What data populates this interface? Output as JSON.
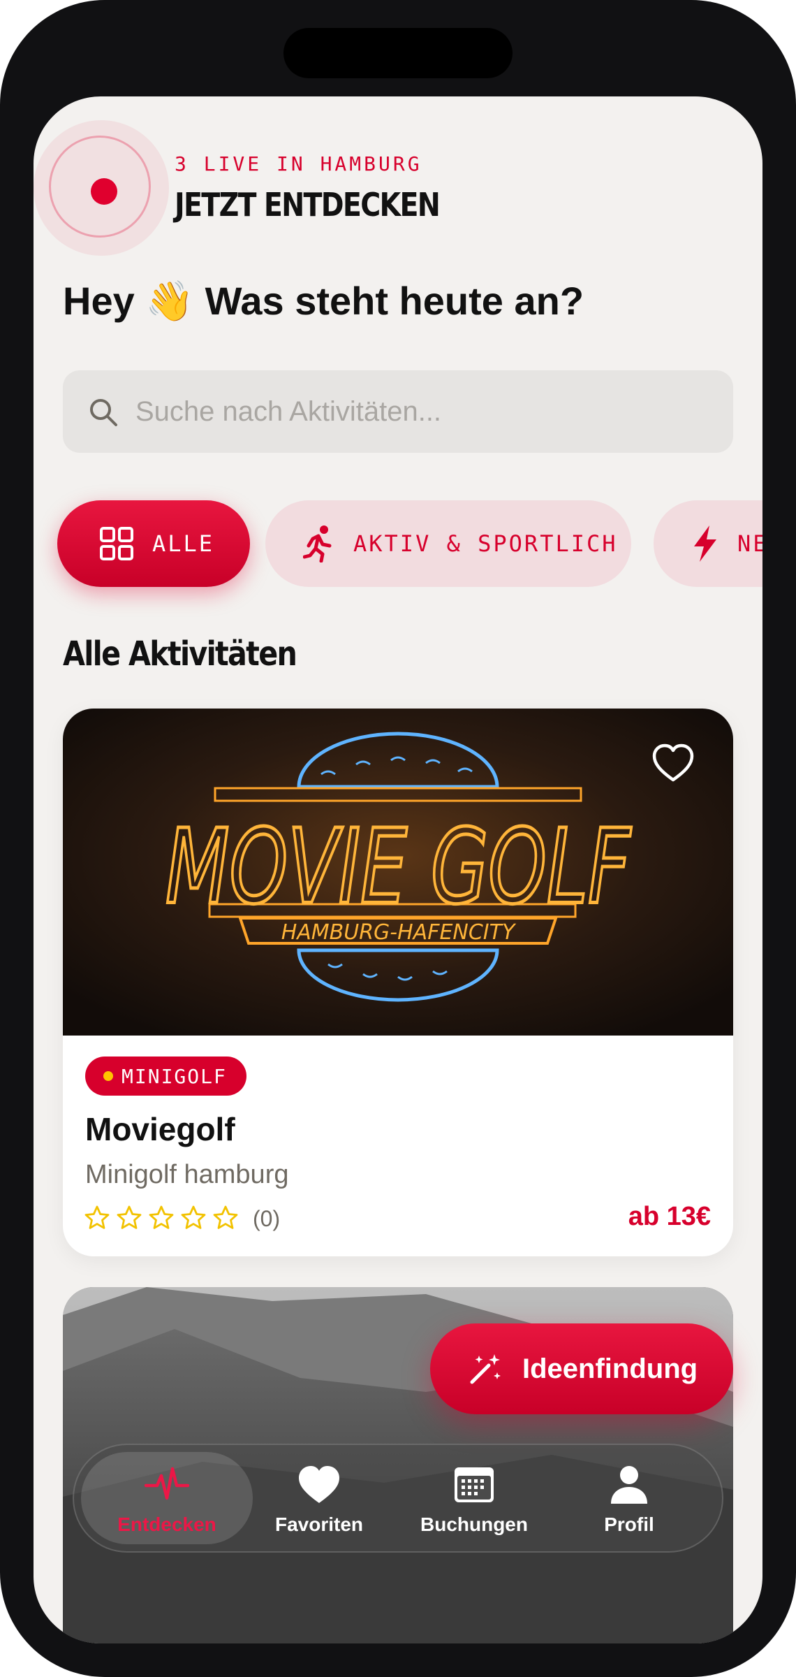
{
  "header": {
    "live_label": "3 LIVE IN HAMBURG",
    "title": "JETZT ENTDECKEN"
  },
  "greeting": "Hey 👋 Was steht heute an?",
  "search": {
    "placeholder": "Suche nach Aktivitäten..."
  },
  "categories": [
    {
      "label": "ALLE",
      "icon": "grid-icon",
      "selected": true
    },
    {
      "label": "AKTIV & SPORTLICH",
      "icon": "running-icon",
      "selected": false
    },
    {
      "label": "NE",
      "icon": "lightning-icon",
      "selected": false
    }
  ],
  "section_title": "Alle Aktivitäten",
  "cards": [
    {
      "image": "movie-golf-neon-sign",
      "image_text": {
        "title": "MOVIE GOLF",
        "subtitle": "HAMBURG-HAFENCITY"
      },
      "badge": "MINIGOLF",
      "title": "Moviegolf",
      "subtitle": "Minigolf hamburg",
      "rating_stars": 0,
      "rating_count": "(0)",
      "price": "ab 13€"
    },
    {
      "image": "mountain-landscape-photo"
    }
  ],
  "fab": {
    "label": "Ideenfindung",
    "icon": "magic-wand-icon"
  },
  "tabs": [
    {
      "label": "Entdecken",
      "icon": "pulse-icon",
      "active": true
    },
    {
      "label": "Favoriten",
      "icon": "heart-icon",
      "active": false
    },
    {
      "label": "Buchungen",
      "icon": "calendar-icon",
      "active": false
    },
    {
      "label": "Profil",
      "icon": "person-icon",
      "active": false
    }
  ],
  "colors": {
    "accent": "#d7002c",
    "background": "#f3f1ef",
    "chip_bg": "#f2dcdf",
    "star": "#f2c200"
  }
}
